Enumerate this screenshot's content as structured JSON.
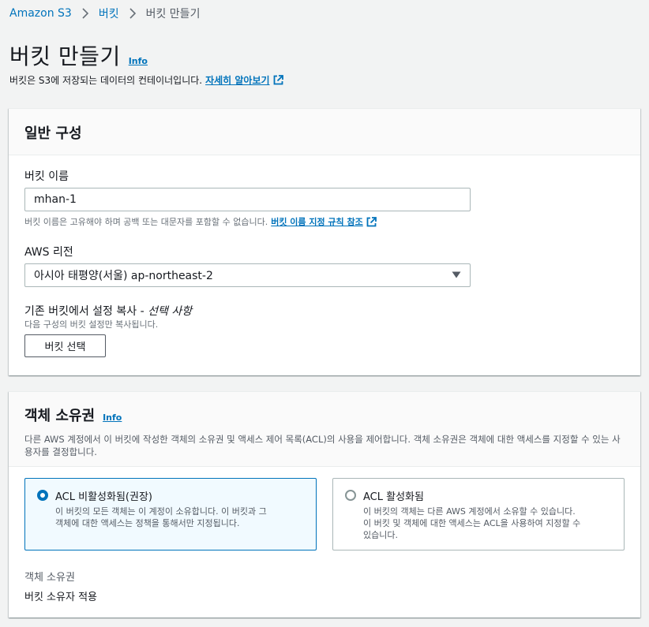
{
  "breadcrumb": {
    "root": "Amazon S3",
    "level2": "버킷",
    "current": "버킷 만들기"
  },
  "page": {
    "title": "버킷 만들기",
    "info": "Info",
    "description": "버킷은 S3에 저장되는 데이터의 컨테이너입니다.",
    "learn_more": "자세히 알아보기"
  },
  "general": {
    "title": "일반 구성",
    "bucket_name_label": "버킷 이름",
    "bucket_name_value": "mhan-1",
    "bucket_name_hint": "버킷 이름은 고유해야 하며 공백 또는 대문자를 포함할 수 없습니다.",
    "bucket_name_rules_link": "버킷 이름 지정 규칙 참조",
    "region_label": "AWS 리전",
    "region_value": "아시아 태평양(서울) ap-northeast-2",
    "copy_label": "기존 버킷에서 설정 복사 -",
    "copy_optional": "선택 사항",
    "copy_hint": "다음 구성의 버킷 설정만 복사됩니다.",
    "choose_bucket_button": "버킷 선택"
  },
  "ownership": {
    "title": "객체 소유권",
    "info": "Info",
    "description": "다른 AWS 계정에서 이 버킷에 작성한 객체의 소유권 및 액세스 제어 목록(ACL)의 사용을 제어합니다. 객체 소유권은 객체에 대한 액세스를 지정할 수 있는 사용자를 결정합니다.",
    "options": [
      {
        "title": "ACL 비활성화됨(권장)",
        "desc1": "이 버킷의 모든 객체는 이 계정이 소유합니다. 이 버킷과 그",
        "desc2": "객체에 대한 액세스는 정책을 통해서만 지정됩니다.",
        "desc3": "",
        "selected": true
      },
      {
        "title": "ACL 활성화됨",
        "desc1": "이 버킷의 객체는 다른 AWS 계정에서 소유할 수 있습니다.",
        "desc2": "이 버킷 및 객체에 대한 액세스는 ACL을 사용하여 지정할 수",
        "desc3": "있습니다.",
        "selected": false
      }
    ],
    "result_label": "객체 소유권",
    "result_value": "버킷 소유자 적용"
  },
  "colors": {
    "link": "#0073bb",
    "selected_bg": "#f1faff",
    "page_bg": "#f2f3f3"
  },
  "icons": {
    "separator": "chevron-right-icon",
    "external": "external-link-icon",
    "dropdown": "caret-down-icon"
  }
}
